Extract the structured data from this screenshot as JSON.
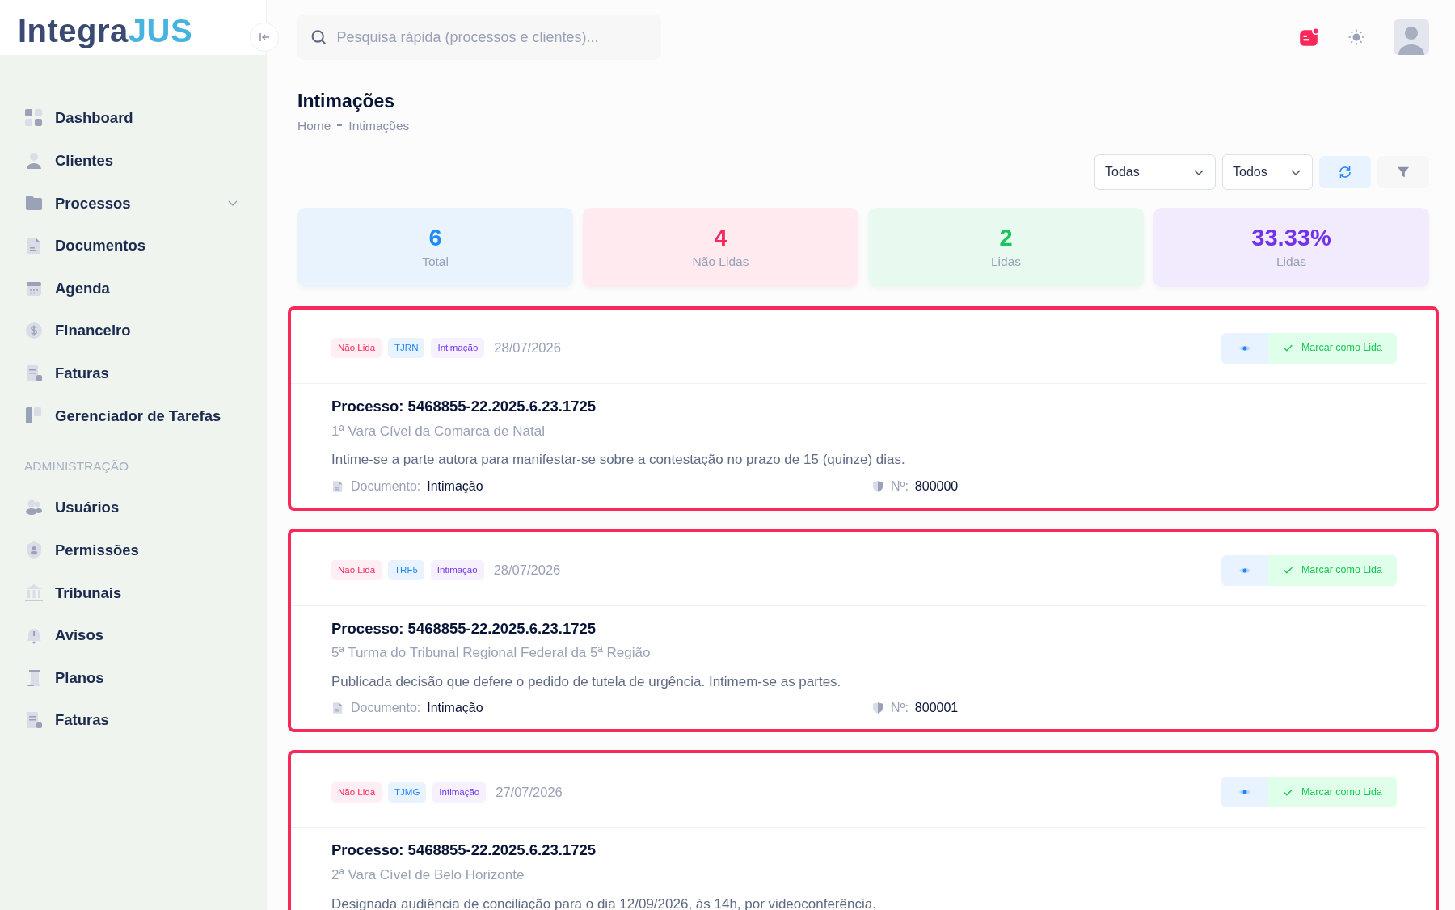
{
  "logo": {
    "part1": "Integra",
    "part2": "JUS"
  },
  "sidebar": {
    "sections": [
      {
        "items": [
          {
            "label": "Dashboard",
            "kind": "link"
          },
          {
            "label": "Clientes",
            "kind": "link"
          },
          {
            "label": "Processos",
            "kind": "submenu",
            "expanded": false
          },
          {
            "label": "Documentos",
            "kind": "link"
          },
          {
            "label": "Agenda",
            "kind": "link"
          },
          {
            "label": "Financeiro",
            "kind": "link"
          },
          {
            "label": "Faturas",
            "kind": "link"
          },
          {
            "label": "Gerenciador de Tarefas",
            "kind": "link"
          }
        ]
      },
      {
        "heading": "ADMINISTRAÇÃO",
        "items": [
          {
            "label": "Usuários",
            "kind": "link"
          },
          {
            "label": "Permissões",
            "kind": "link"
          },
          {
            "label": "Tribunais",
            "kind": "link"
          },
          {
            "label": "Avisos",
            "kind": "link"
          },
          {
            "label": "Planos",
            "kind": "link"
          },
          {
            "label": "Faturas",
            "kind": "link"
          }
        ]
      }
    ]
  },
  "search": {
    "placeholder": "Pesquisa rápida (processos e clientes)..."
  },
  "header": {
    "notification_dot": true
  },
  "page": {
    "title": "Intimações",
    "breadcrumb": [
      "Home",
      "Intimações"
    ]
  },
  "filters": [
    {
      "value": "Todas"
    },
    {
      "value": "Todos"
    }
  ],
  "stats": [
    {
      "value": "6",
      "label": "Total",
      "color": "#1f8bf5"
    },
    {
      "value": "4",
      "label": "Não Lidas",
      "color": "#f4295a"
    },
    {
      "value": "2",
      "label": "Lidas",
      "color": "#19c45a"
    },
    {
      "value": "33.33%",
      "label": "Lidas",
      "color": "#7233e8"
    }
  ],
  "intimacoes": [
    {
      "highlighted": true,
      "tags": [
        {
          "text": "Não Lida",
          "kind": "status"
        },
        {
          "text": "TJRN",
          "kind": "court"
        },
        {
          "text": "Intimação",
          "kind": "type"
        }
      ],
      "date": "28/07/2026",
      "action": "Marcar como Lida",
      "process": "Processo: 5468855-22.2025.6.23.1725",
      "court": "1ª Vara Cível da Comarca de Natal",
      "text": "Intime-se a parte autora para manifestar-se sobre a contestação no prazo de 15 (quinze) dias.",
      "doc_label": "Documento:",
      "doc_value": "Intimação",
      "num_label": "Nº:",
      "num_value": "800000"
    },
    {
      "highlighted": true,
      "tags": [
        {
          "text": "Não Lida",
          "kind": "status"
        },
        {
          "text": "TRF5",
          "kind": "court"
        },
        {
          "text": "Intimação",
          "kind": "type"
        }
      ],
      "date": "28/07/2026",
      "action": "Marcar como Lida",
      "process": "Processo: 5468855-22.2025.6.23.1725",
      "court": "5ª Turma do Tribunal Regional Federal da 5ª Região",
      "text": "Publicada decisão que defere o pedido de tutela de urgência. Intimem-se as partes.",
      "doc_label": "Documento:",
      "doc_value": "Intimação",
      "num_label": "Nº:",
      "num_value": "800001"
    },
    {
      "highlighted": true,
      "tags": [
        {
          "text": "Não Lida",
          "kind": "status"
        },
        {
          "text": "TJMG",
          "kind": "court"
        },
        {
          "text": "Intimação",
          "kind": "type"
        }
      ],
      "date": "27/07/2026",
      "action": "Marcar como Lida",
      "process": "Processo: 5468855-22.2025.6.23.1725",
      "court": "2ª Vara Cível de Belo Horizonte",
      "text": "Designada audiência de conciliação para o dia 12/09/2026, às 14h, por videoconferência."
    }
  ]
}
